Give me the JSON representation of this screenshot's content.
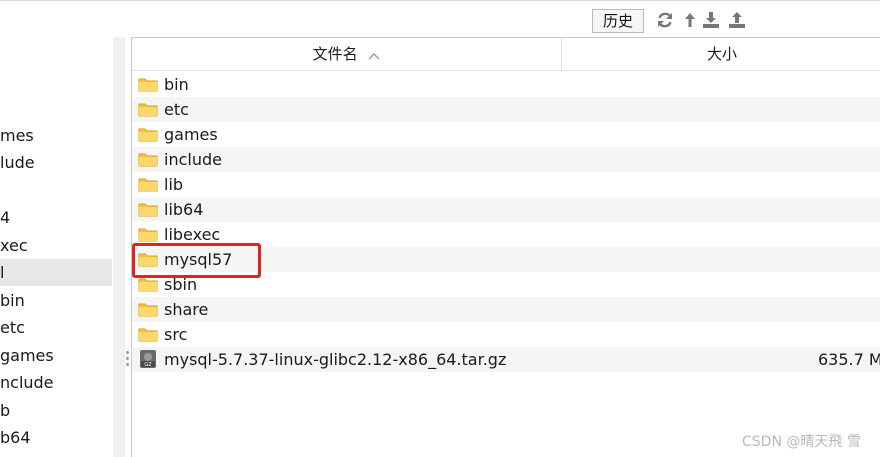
{
  "toolbar": {
    "history_label": "历史",
    "icons": [
      "refresh-icon",
      "up-arrow-icon",
      "download-icon",
      "upload-icon"
    ]
  },
  "left_tree": {
    "items": [
      {
        "label": "mes",
        "selected": false
      },
      {
        "label": "lude",
        "selected": false
      },
      {
        "label": "4",
        "selected": false
      },
      {
        "label": "xec",
        "selected": false
      },
      {
        "label": "l",
        "selected": true
      },
      {
        "label": "bin",
        "selected": false
      },
      {
        "label": "etc",
        "selected": false
      },
      {
        "label": "games",
        "selected": false
      },
      {
        "label": "nclude",
        "selected": false
      },
      {
        "label": "b",
        "selected": false
      },
      {
        "label": "b64",
        "selected": false
      }
    ]
  },
  "file_list": {
    "columns": {
      "name": "文件名",
      "size": "大小"
    },
    "rows": [
      {
        "name": "bin",
        "type": "folder",
        "size": ""
      },
      {
        "name": "etc",
        "type": "folder",
        "size": ""
      },
      {
        "name": "games",
        "type": "folder",
        "size": ""
      },
      {
        "name": "include",
        "type": "folder",
        "size": ""
      },
      {
        "name": "lib",
        "type": "folder",
        "size": ""
      },
      {
        "name": "lib64",
        "type": "folder",
        "size": ""
      },
      {
        "name": "libexec",
        "type": "folder",
        "size": ""
      },
      {
        "name": "mysql57",
        "type": "folder",
        "size": "",
        "highlighted": true
      },
      {
        "name": "sbin",
        "type": "folder",
        "size": ""
      },
      {
        "name": "share",
        "type": "folder",
        "size": ""
      },
      {
        "name": "src",
        "type": "folder",
        "size": ""
      },
      {
        "name": "mysql-5.7.37-linux-glibc2.12-x86_64.tar.gz",
        "type": "archive",
        "size": "635.7 M"
      }
    ]
  },
  "colors": {
    "highlight": "#e0241c",
    "folder": "#f5c342"
  },
  "watermark": "CSDN @晴天飛 雪"
}
